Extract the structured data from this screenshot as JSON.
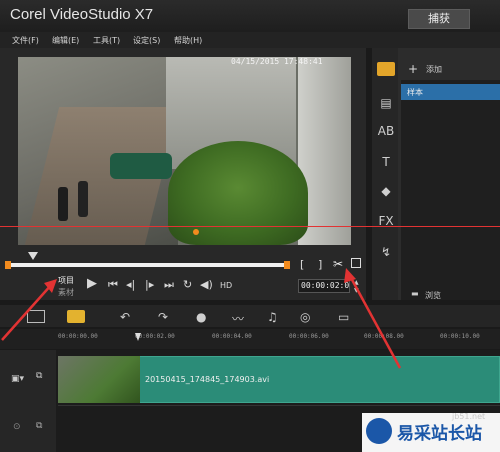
{
  "window": {
    "title": "Corel VideoStudio X7",
    "capture_label": "捕获"
  },
  "menu": [
    "文件(F)",
    "编辑(E)",
    "工具(T)",
    "设定(S)",
    "帮助(H)"
  ],
  "preview": {
    "timestamp": "04/15/2015 17:48:41"
  },
  "player": {
    "mode_project": "项目",
    "mode_clip": "素材",
    "hd_label": "HD",
    "timecode": "00:00:02:0",
    "bracket_in": "[",
    "bracket_out": "]"
  },
  "library": {
    "add_label": "添加",
    "sample_label": "样本",
    "browse_label": "浏览"
  },
  "ruler": [
    "00:00:00.00",
    "00:00:02.00",
    "00:00:04.00",
    "00:00:06.00",
    "00:00:08.00",
    "00:00:10.00"
  ],
  "timeline": {
    "clip_name": "20150415_174845_174903.avi"
  },
  "watermark": {
    "text": "易采站长站",
    "url": "jb51.net"
  },
  "colors": {
    "accent": "#f28b1e",
    "clip": "#2b8c78",
    "selection": "#2b6fa8",
    "annotation": "#e23333"
  }
}
